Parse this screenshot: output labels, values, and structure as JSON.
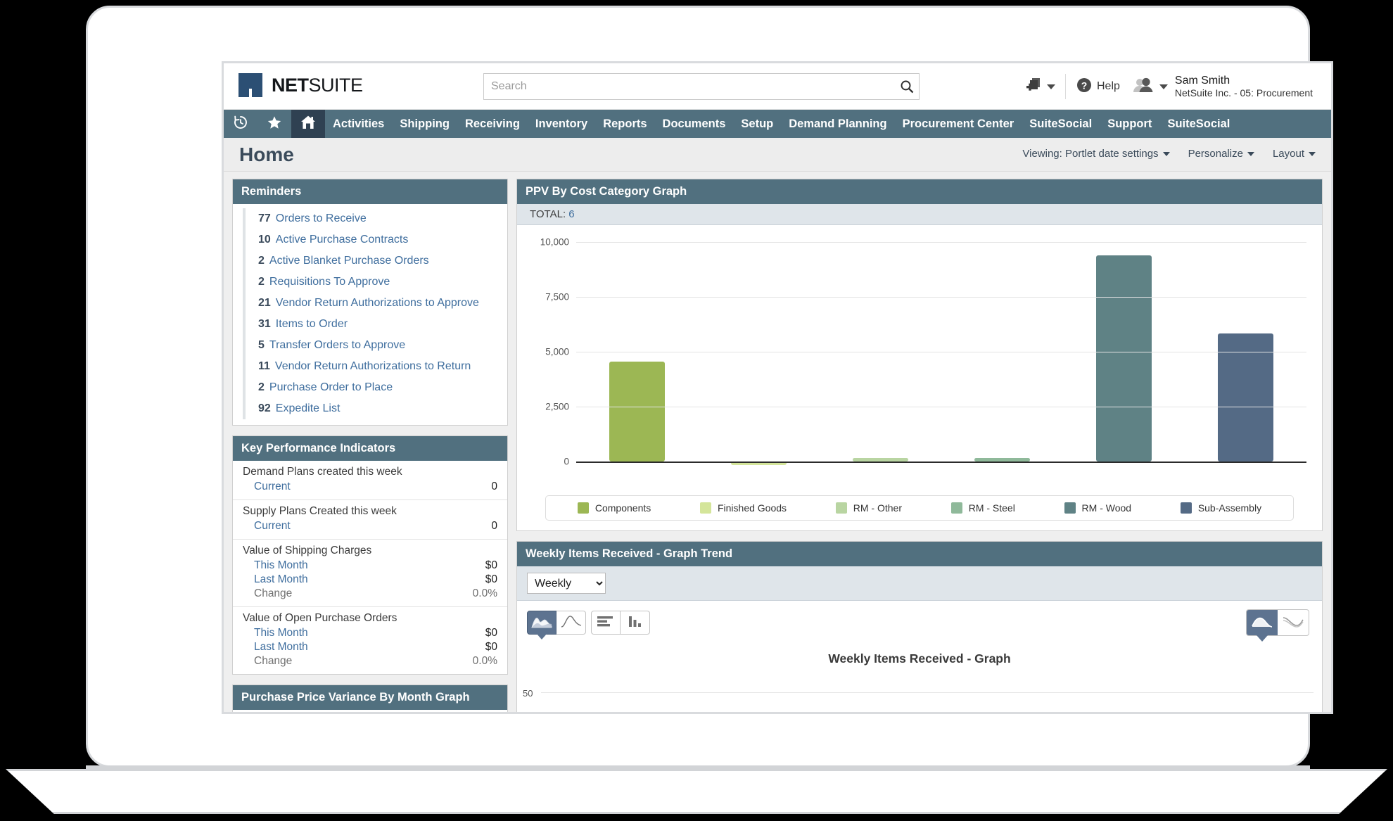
{
  "brand": {
    "name_bold": "NET",
    "name_light": "SUITE",
    "logo_icon": "netsuite-n-logo",
    "accent": "#51707f",
    "navbar_active": "#2f4152"
  },
  "search": {
    "placeholder": "Search",
    "value": "",
    "icon": "search-icon"
  },
  "topbar": {
    "quick_add_icon": "add-document-icon",
    "help_icon": "help-circle-icon",
    "help_label": "Help",
    "user_icon": "user-avatar-icon",
    "user_name": "Sam Smith",
    "user_role": "NetSuite Inc. - 05: Procurement"
  },
  "nav": {
    "icons": [
      {
        "name": "recent-history-icon",
        "glyph": "recent"
      },
      {
        "name": "favorites-star-icon",
        "glyph": "star"
      },
      {
        "name": "home-icon",
        "glyph": "home",
        "active": true
      }
    ],
    "links": [
      "Activities",
      "Shipping",
      "Receiving",
      "Inventory",
      "Reports",
      "Documents",
      "Setup",
      "Demand Planning",
      "Procurement Center",
      "SuiteSocial",
      "Support",
      "SuiteSocial"
    ]
  },
  "page": {
    "title": "Home",
    "actions": [
      {
        "label": "Viewing: Portlet date settings",
        "caret": true
      },
      {
        "label": "Personalize",
        "caret": true
      },
      {
        "label": "Layout",
        "caret": true
      }
    ]
  },
  "reminders": {
    "title": "Reminders",
    "items": [
      {
        "count": "77",
        "label": "Orders to Receive"
      },
      {
        "count": "10",
        "label": "Active Purchase Contracts"
      },
      {
        "count": "2",
        "label": "Active Blanket Purchase Orders"
      },
      {
        "count": "2",
        "label": "Requisitions To Approve"
      },
      {
        "count": "21",
        "label": "Vendor Return Authorizations to Approve"
      },
      {
        "count": "31",
        "label": "Items to Order"
      },
      {
        "count": "5",
        "label": "Transfer Orders to Approve"
      },
      {
        "count": "11",
        "label": "Vendor Return Authorizations to Return"
      },
      {
        "count": "2",
        "label": "Purchase Order to Place"
      },
      {
        "count": "92",
        "label": "Expedite List"
      }
    ]
  },
  "kpi": {
    "title": "Key Performance Indicators",
    "groups": [
      {
        "name": "Demand Plans created this week",
        "rows": [
          {
            "key": "Current",
            "value": "0",
            "muted": false
          }
        ]
      },
      {
        "name": "Supply Plans Created this week",
        "rows": [
          {
            "key": "Current",
            "value": "0",
            "muted": false
          }
        ]
      },
      {
        "name": "Value of Shipping Charges",
        "rows": [
          {
            "key": "This Month",
            "value": "$0",
            "muted": false
          },
          {
            "key": "Last Month",
            "value": "$0",
            "muted": false
          },
          {
            "key": "Change",
            "value": "0.0%",
            "muted": true
          }
        ]
      },
      {
        "name": "Value of Open Purchase Orders",
        "rows": [
          {
            "key": "This Month",
            "value": "$0",
            "muted": false
          },
          {
            "key": "Last Month",
            "value": "$0",
            "muted": false
          },
          {
            "key": "Change",
            "value": "0.0%",
            "muted": true
          }
        ]
      }
    ]
  },
  "ppv_portlet": {
    "title": "PPV By Cost Category Graph",
    "total_label": "TOTAL:",
    "total_value": "6"
  },
  "ppv_variance_portlet": {
    "title": "Purchase Price Variance By Month Graph"
  },
  "weekly_portlet": {
    "title": "Weekly Items Received - Graph Trend",
    "period_selected": "Weekly",
    "period_options": [
      "Weekly"
    ],
    "chart_type_buttons": [
      {
        "name": "stacked-area-chart-icon",
        "selected": true
      },
      {
        "name": "area-chart-icon",
        "selected": false
      },
      {
        "name": "horizontal-bar-chart-icon",
        "selected": false
      },
      {
        "name": "vertical-bar-chart-icon",
        "selected": false
      }
    ],
    "style_toggle": [
      {
        "name": "filled-style-icon",
        "selected": true
      },
      {
        "name": "line-style-icon",
        "selected": false
      }
    ]
  },
  "chart_data": [
    {
      "type": "bar",
      "title": "PPV By Cost Category Graph",
      "xlabel": "",
      "ylabel": "",
      "ylim": [
        0,
        10000
      ],
      "yticks": [
        "0",
        "2,500",
        "5,000",
        "7,500",
        "10,000"
      ],
      "ytick_values": [
        0,
        2500,
        5000,
        7500,
        10000
      ],
      "grid": true,
      "legend_position": "bottom",
      "categories": [
        "Components",
        "Finished Goods",
        "RM - Other",
        "RM - Steel",
        "RM - Wood",
        "Sub-Assembly"
      ],
      "values": [
        4550,
        -120,
        60,
        70,
        9380,
        5820
      ],
      "colors": [
        "#9cb754",
        "#d4e59a",
        "#b9d5a2",
        "#8fb99a",
        "#5f8285",
        "#546a85"
      ],
      "series": [
        {
          "name": "Components",
          "values": [
            4550
          ]
        },
        {
          "name": "Finished Goods",
          "values": [
            -120
          ]
        },
        {
          "name": "RM - Other",
          "values": [
            60
          ]
        },
        {
          "name": "RM - Steel",
          "values": [
            70
          ]
        },
        {
          "name": "RM - Wood",
          "values": [
            9380
          ]
        },
        {
          "name": "Sub-Assembly",
          "values": [
            5820
          ]
        }
      ]
    },
    {
      "type": "area",
      "title": "Weekly Items Received - Graph",
      "xlabel": "",
      "ylabel": "",
      "yticks": [
        "50"
      ],
      "ytick_values": [
        50
      ],
      "grid": true,
      "categories": [],
      "values": []
    }
  ]
}
